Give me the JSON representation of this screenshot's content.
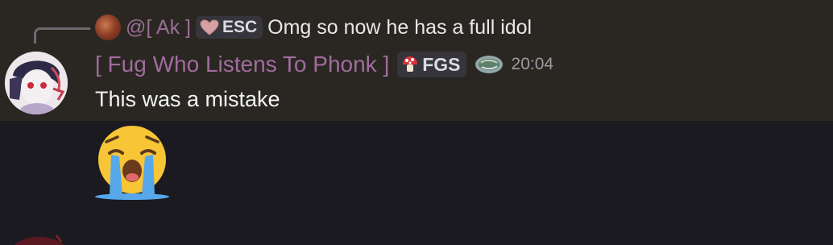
{
  "reply": {
    "author": "@[ Ak ]",
    "tag": "ESC",
    "text": "Omg so now he has a full idol"
  },
  "message": {
    "author": "[ Fug Who Listens To Phonk ]",
    "tag": "FGS",
    "timestamp": "20:04",
    "text": "This was a mistake",
    "emoji": "loudly-crying-face"
  },
  "colors": {
    "highlight_bg": "#2a2722",
    "username": "#a16c9e",
    "reply_name": "#9a6e95",
    "background": "#1b1a20"
  }
}
